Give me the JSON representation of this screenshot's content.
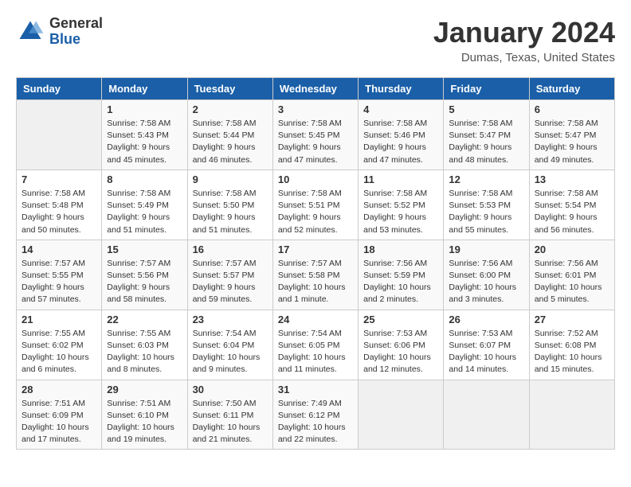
{
  "logo": {
    "general": "General",
    "blue": "Blue"
  },
  "header": {
    "title": "January 2024",
    "subtitle": "Dumas, Texas, United States"
  },
  "weekdays": [
    "Sunday",
    "Monday",
    "Tuesday",
    "Wednesday",
    "Thursday",
    "Friday",
    "Saturday"
  ],
  "weeks": [
    [
      {
        "day": "",
        "info": ""
      },
      {
        "day": "1",
        "info": "Sunrise: 7:58 AM\nSunset: 5:43 PM\nDaylight: 9 hours\nand 45 minutes."
      },
      {
        "day": "2",
        "info": "Sunrise: 7:58 AM\nSunset: 5:44 PM\nDaylight: 9 hours\nand 46 minutes."
      },
      {
        "day": "3",
        "info": "Sunrise: 7:58 AM\nSunset: 5:45 PM\nDaylight: 9 hours\nand 47 minutes."
      },
      {
        "day": "4",
        "info": "Sunrise: 7:58 AM\nSunset: 5:46 PM\nDaylight: 9 hours\nand 47 minutes."
      },
      {
        "day": "5",
        "info": "Sunrise: 7:58 AM\nSunset: 5:47 PM\nDaylight: 9 hours\nand 48 minutes."
      },
      {
        "day": "6",
        "info": "Sunrise: 7:58 AM\nSunset: 5:47 PM\nDaylight: 9 hours\nand 49 minutes."
      }
    ],
    [
      {
        "day": "7",
        "info": "Sunrise: 7:58 AM\nSunset: 5:48 PM\nDaylight: 9 hours\nand 50 minutes."
      },
      {
        "day": "8",
        "info": "Sunrise: 7:58 AM\nSunset: 5:49 PM\nDaylight: 9 hours\nand 51 minutes."
      },
      {
        "day": "9",
        "info": "Sunrise: 7:58 AM\nSunset: 5:50 PM\nDaylight: 9 hours\nand 51 minutes."
      },
      {
        "day": "10",
        "info": "Sunrise: 7:58 AM\nSunset: 5:51 PM\nDaylight: 9 hours\nand 52 minutes."
      },
      {
        "day": "11",
        "info": "Sunrise: 7:58 AM\nSunset: 5:52 PM\nDaylight: 9 hours\nand 53 minutes."
      },
      {
        "day": "12",
        "info": "Sunrise: 7:58 AM\nSunset: 5:53 PM\nDaylight: 9 hours\nand 55 minutes."
      },
      {
        "day": "13",
        "info": "Sunrise: 7:58 AM\nSunset: 5:54 PM\nDaylight: 9 hours\nand 56 minutes."
      }
    ],
    [
      {
        "day": "14",
        "info": "Sunrise: 7:57 AM\nSunset: 5:55 PM\nDaylight: 9 hours\nand 57 minutes."
      },
      {
        "day": "15",
        "info": "Sunrise: 7:57 AM\nSunset: 5:56 PM\nDaylight: 9 hours\nand 58 minutes."
      },
      {
        "day": "16",
        "info": "Sunrise: 7:57 AM\nSunset: 5:57 PM\nDaylight: 9 hours\nand 59 minutes."
      },
      {
        "day": "17",
        "info": "Sunrise: 7:57 AM\nSunset: 5:58 PM\nDaylight: 10 hours\nand 1 minute."
      },
      {
        "day": "18",
        "info": "Sunrise: 7:56 AM\nSunset: 5:59 PM\nDaylight: 10 hours\nand 2 minutes."
      },
      {
        "day": "19",
        "info": "Sunrise: 7:56 AM\nSunset: 6:00 PM\nDaylight: 10 hours\nand 3 minutes."
      },
      {
        "day": "20",
        "info": "Sunrise: 7:56 AM\nSunset: 6:01 PM\nDaylight: 10 hours\nand 5 minutes."
      }
    ],
    [
      {
        "day": "21",
        "info": "Sunrise: 7:55 AM\nSunset: 6:02 PM\nDaylight: 10 hours\nand 6 minutes."
      },
      {
        "day": "22",
        "info": "Sunrise: 7:55 AM\nSunset: 6:03 PM\nDaylight: 10 hours\nand 8 minutes."
      },
      {
        "day": "23",
        "info": "Sunrise: 7:54 AM\nSunset: 6:04 PM\nDaylight: 10 hours\nand 9 minutes."
      },
      {
        "day": "24",
        "info": "Sunrise: 7:54 AM\nSunset: 6:05 PM\nDaylight: 10 hours\nand 11 minutes."
      },
      {
        "day": "25",
        "info": "Sunrise: 7:53 AM\nSunset: 6:06 PM\nDaylight: 10 hours\nand 12 minutes."
      },
      {
        "day": "26",
        "info": "Sunrise: 7:53 AM\nSunset: 6:07 PM\nDaylight: 10 hours\nand 14 minutes."
      },
      {
        "day": "27",
        "info": "Sunrise: 7:52 AM\nSunset: 6:08 PM\nDaylight: 10 hours\nand 15 minutes."
      }
    ],
    [
      {
        "day": "28",
        "info": "Sunrise: 7:51 AM\nSunset: 6:09 PM\nDaylight: 10 hours\nand 17 minutes."
      },
      {
        "day": "29",
        "info": "Sunrise: 7:51 AM\nSunset: 6:10 PM\nDaylight: 10 hours\nand 19 minutes."
      },
      {
        "day": "30",
        "info": "Sunrise: 7:50 AM\nSunset: 6:11 PM\nDaylight: 10 hours\nand 21 minutes."
      },
      {
        "day": "31",
        "info": "Sunrise: 7:49 AM\nSunset: 6:12 PM\nDaylight: 10 hours\nand 22 minutes."
      },
      {
        "day": "",
        "info": ""
      },
      {
        "day": "",
        "info": ""
      },
      {
        "day": "",
        "info": ""
      }
    ]
  ]
}
